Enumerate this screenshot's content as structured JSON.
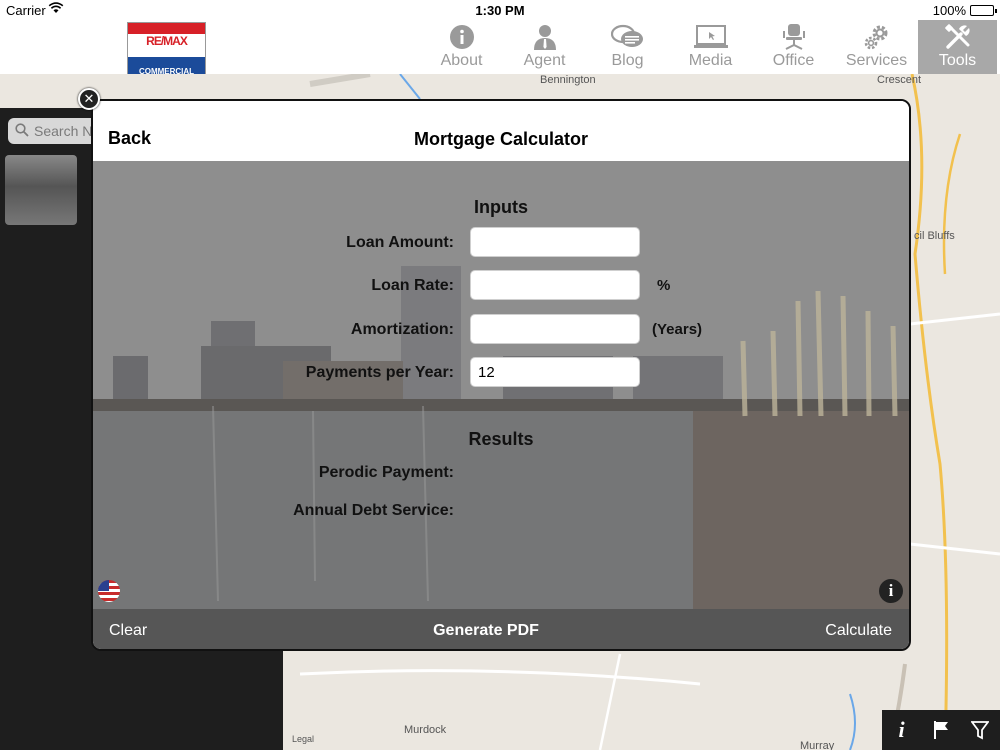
{
  "status_bar": {
    "carrier": "Carrier",
    "time": "1:30 PM",
    "battery": "100%"
  },
  "logo": {
    "brand": "RE/MAX",
    "sub": "COMMERCIAL"
  },
  "nav": {
    "items": [
      {
        "label": "About",
        "icon": "info-circle-icon"
      },
      {
        "label": "Agent",
        "icon": "person-icon"
      },
      {
        "label": "Blog",
        "icon": "chat-bubbles-icon"
      },
      {
        "label": "Media",
        "icon": "laptop-icon"
      },
      {
        "label": "Office",
        "icon": "office-chair-icon"
      },
      {
        "label": "Services",
        "icon": "gears-icon"
      },
      {
        "label": "Tools",
        "icon": "tools-icon",
        "active": true
      }
    ]
  },
  "map": {
    "search_placeholder": "Search N",
    "labels": {
      "bennington": "Bennington",
      "crescent": "Crescent",
      "bluffs": "cil Bluffs",
      "murdock": "Murdock",
      "murray": "Murray",
      "legal": "Legal"
    }
  },
  "modal": {
    "back": "Back",
    "title": "Mortgage Calculator",
    "inputs_title": "Inputs",
    "fields": {
      "loan_amount": {
        "label": "Loan Amount:",
        "value": ""
      },
      "loan_rate": {
        "label": "Loan Rate:",
        "value": "",
        "unit": "%"
      },
      "amortization": {
        "label": "Amortization:",
        "value": "",
        "unit": "(Years)"
      },
      "payments_per_year": {
        "label": "Payments per Year:",
        "value": "12"
      }
    },
    "results_title": "Results",
    "results": {
      "periodic_payment": {
        "label": "Perodic Payment:"
      },
      "annual_debt_service": {
        "label": "Annual Debt Service:"
      }
    },
    "footer": {
      "clear": "Clear",
      "generate_pdf": "Generate PDF",
      "calculate": "Calculate"
    }
  },
  "colors": {
    "active_tab": "#a8a8a8",
    "footer_bar": "#565656",
    "remax_red": "#d72027",
    "remax_blue": "#1b4b9a"
  }
}
